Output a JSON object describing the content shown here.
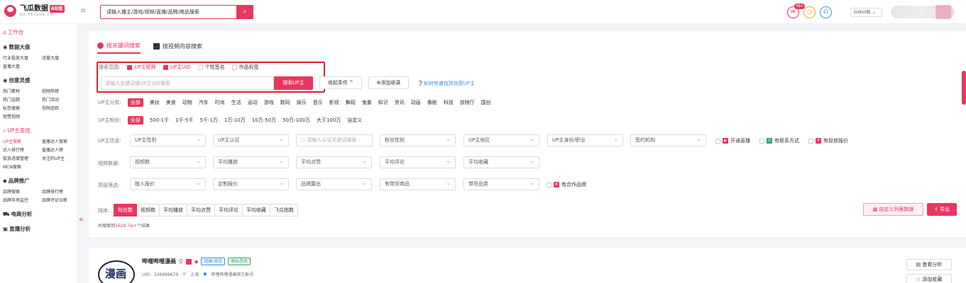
{
  "header": {
    "logo_text": "飞瓜数据",
    "logo_badge": "B站版",
    "logo_sub": "BZ.FEIGUA.CN",
    "search_placeholder": "请输入播主/游戏/视频/直播/品牌/商品搜索",
    "notif_count": "99+",
    "platform": "bilibili版"
  },
  "sidebar": {
    "workbench": "工作台",
    "sections": [
      {
        "title": "数据大盘",
        "items": [
          "行业投放大盘",
          "流量大盘",
          "直播大盘"
        ]
      },
      {
        "title": "创意灵感",
        "items": [
          "热门素材",
          "视频热榜",
          "热门话题",
          "热门活动",
          "标签搜索",
          "视频追踪",
          "悦赞视频"
        ]
      },
      {
        "title": "UP主查找",
        "items": [
          "UP主搜索",
          "直播达人搜索",
          "达人排行榜",
          "直播达人榜",
          "投放进度管理",
          "关注的UP主",
          "MCN搜索"
        ]
      },
      {
        "title": "品牌推广",
        "items": [
          "品牌搜索",
          "品牌排行榜",
          "品牌市场监控",
          "品牌评论诊断"
        ]
      },
      {
        "title": "电商分析",
        "items": []
      },
      {
        "title": "直播分析",
        "items": []
      }
    ]
  },
  "tabs": [
    "按关键词搜索",
    "按视频内容搜索"
  ],
  "scope": {
    "label": "搜索范围:",
    "options": [
      {
        "label": "UP主昵称",
        "checked": true
      },
      {
        "label": "UP主UID",
        "checked": true
      },
      {
        "label": "个性签名",
        "checked": false
      },
      {
        "label": "作品标签",
        "checked": false
      }
    ]
  },
  "keyword": {
    "placeholder": "请输入关键词或UP主UID搜索",
    "search_btn": "搜索UP主",
    "collapse_btn": "收起条件 ^",
    "add_btn": "⊕添加收录",
    "help_link": "如何快速找到优质UP主"
  },
  "category": {
    "label": "UP主分类:",
    "items": [
      "全部",
      "美妆",
      "美食",
      "动物",
      "汽车",
      "时尚",
      "生活",
      "运动",
      "游戏",
      "数码",
      "娱乐",
      "音乐",
      "影视",
      "舞蹈",
      "鬼畜",
      "知识",
      "资讯",
      "动画",
      "番剧",
      "科技",
      "放映厅",
      "国创"
    ]
  },
  "fans": {
    "label": "UP主粉丝:",
    "items": [
      "全部",
      "500-1千",
      "1千-5千",
      "5千-1万",
      "1万-10万",
      "10万-50万",
      "50万-100万",
      "大于100万",
      "自定义"
    ]
  },
  "up_info": {
    "label": "UP主信息:",
    "selects": [
      "UP主性别",
      "UP主认证",
      "请输入认证关键词搜索",
      "粉丝性别",
      "UP主地区",
      "UP主身份/职业",
      "签约机构"
    ],
    "flags": [
      "开通直播",
      "有联系方式",
      "有投放报价"
    ],
    "flag_colors": [
      "#e8365f",
      "#38a169",
      "#e8365f"
    ]
  },
  "video_data": {
    "label": "视频数据:",
    "selects": [
      "视频数",
      "平均播放",
      "平均点赞",
      "平均评论",
      "平均收藏"
    ]
  },
  "advanced": {
    "label": "高级筛选:",
    "selects": [
      "植入报价",
      "定制报价",
      "品牌露出",
      "有带货商品",
      "带货品类"
    ],
    "flag": "有合作品牌"
  },
  "sort": {
    "label": "排序:",
    "items": [
      "粉丝数",
      "视频数",
      "平均播放",
      "平均点赞",
      "平均评论",
      "平均收藏",
      "飞瓜指数"
    ],
    "custom_btn": "自定义列表数据",
    "export_btn": "导出"
  },
  "result": {
    "prefix": "共搜索到",
    "count": "1629.7w+",
    "suffix": "个结果"
  },
  "card": {
    "name": "哔哩哔哩漫画",
    "tags": [
      "动画·综合",
      "原标签名"
    ],
    "uid": "UID：326499679",
    "location": "上海",
    "cert": "哔哩哔哩漫画官方账号",
    "avatar_text": "漫画",
    "view_btn": "查看分析",
    "collect_btn": "添加收藏"
  }
}
